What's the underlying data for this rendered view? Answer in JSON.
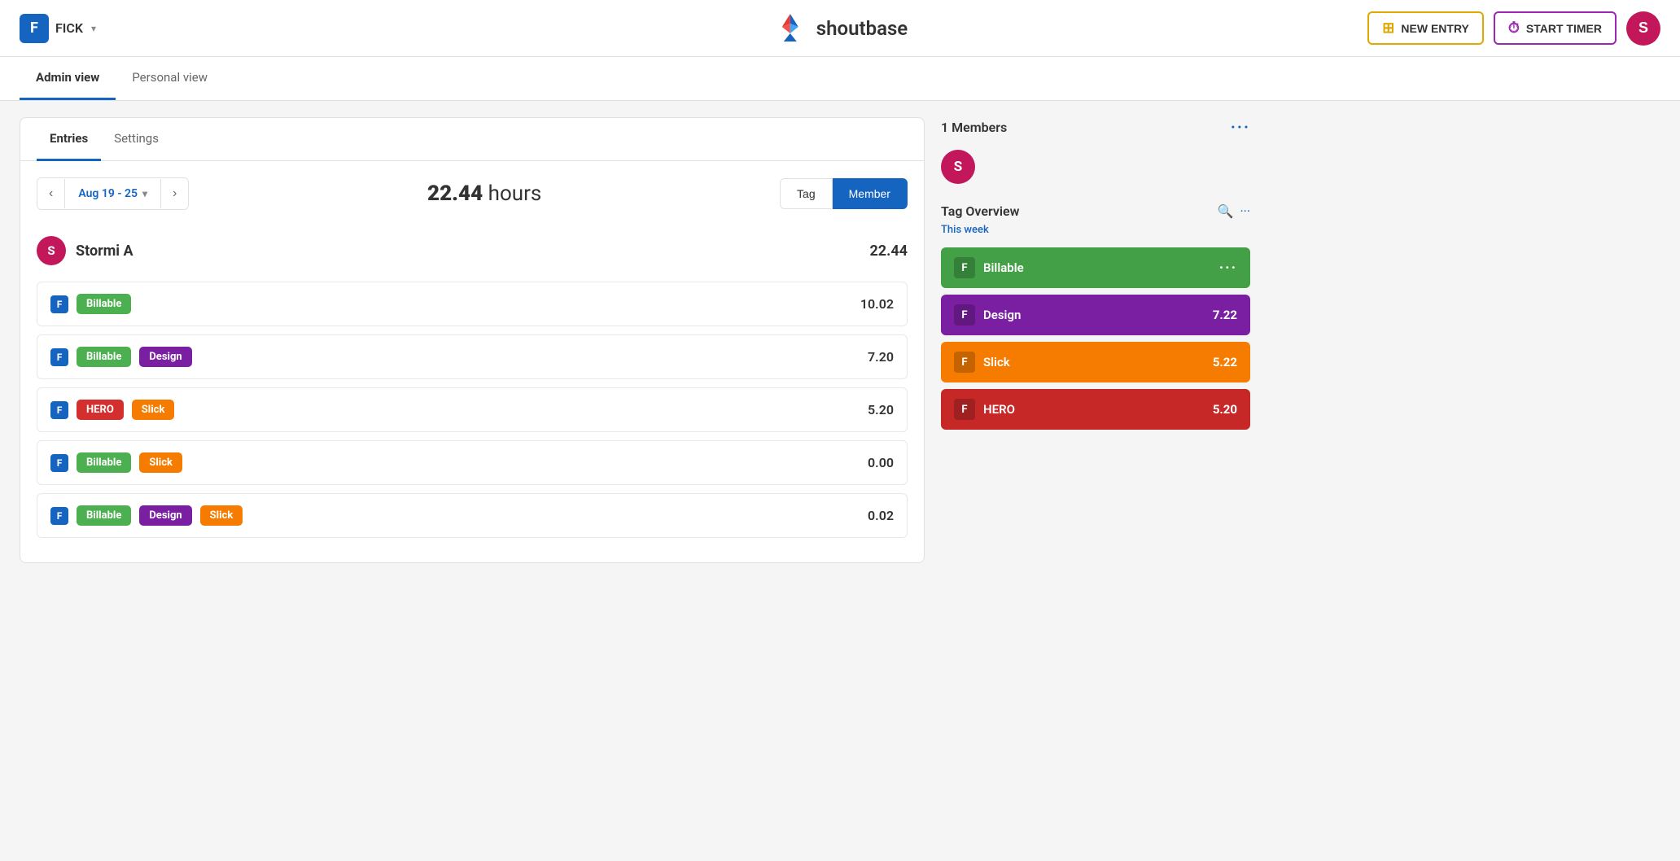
{
  "header": {
    "workspace_letter": "F",
    "workspace_name": "FICK",
    "brand_name": "shoutbase",
    "new_entry_label": "NEW ENTRY",
    "start_timer_label": "START TIMER",
    "user_avatar_letter": "S"
  },
  "view_tabs": [
    {
      "id": "admin",
      "label": "Admin view",
      "active": true
    },
    {
      "id": "personal",
      "label": "Personal view",
      "active": false
    }
  ],
  "card": {
    "tabs": [
      {
        "id": "entries",
        "label": "Entries",
        "active": true
      },
      {
        "id": "settings",
        "label": "Settings",
        "active": false
      }
    ],
    "date_range": "Aug 19 - 25",
    "total_hours_value": "22.44",
    "total_hours_unit": "hours",
    "filter_tag_label": "Tag",
    "filter_member_label": "Member",
    "user": {
      "avatar_letter": "S",
      "name": "Stormi A",
      "hours": "22.44"
    },
    "entries": [
      {
        "tags": [
          {
            "label": "Billable",
            "color": "#4caf50"
          }
        ],
        "hours": "10.02"
      },
      {
        "tags": [
          {
            "label": "Billable",
            "color": "#4caf50"
          },
          {
            "label": "Design",
            "color": "#7b1fa2"
          }
        ],
        "hours": "7.20"
      },
      {
        "tags": [
          {
            "label": "HERO",
            "color": "#d32f2f"
          },
          {
            "label": "Slick",
            "color": "#f57c00"
          }
        ],
        "hours": "5.20"
      },
      {
        "tags": [
          {
            "label": "Billable",
            "color": "#4caf50"
          },
          {
            "label": "Slick",
            "color": "#f57c00"
          }
        ],
        "hours": "0.00"
      },
      {
        "tags": [
          {
            "label": "Billable",
            "color": "#4caf50"
          },
          {
            "label": "Design",
            "color": "#7b1fa2"
          },
          {
            "label": "Slick",
            "color": "#f57c00"
          }
        ],
        "hours": "0.02"
      }
    ]
  },
  "sidebar": {
    "members_count": "1 Members",
    "member_avatar_letter": "S",
    "tag_overview_title": "Tag Overview",
    "this_week_label": "This",
    "this_week_value": "week",
    "tags": [
      {
        "label": "Billable",
        "color": "#43a047",
        "value": null,
        "show_dots": true
      },
      {
        "label": "Design",
        "color": "#7b1fa2",
        "value": "7.22",
        "show_dots": false
      },
      {
        "label": "Slick",
        "color": "#f57c00",
        "value": "5.22",
        "show_dots": false
      },
      {
        "label": "HERO",
        "color": "#c62828",
        "value": "5.20",
        "show_dots": false
      }
    ]
  }
}
